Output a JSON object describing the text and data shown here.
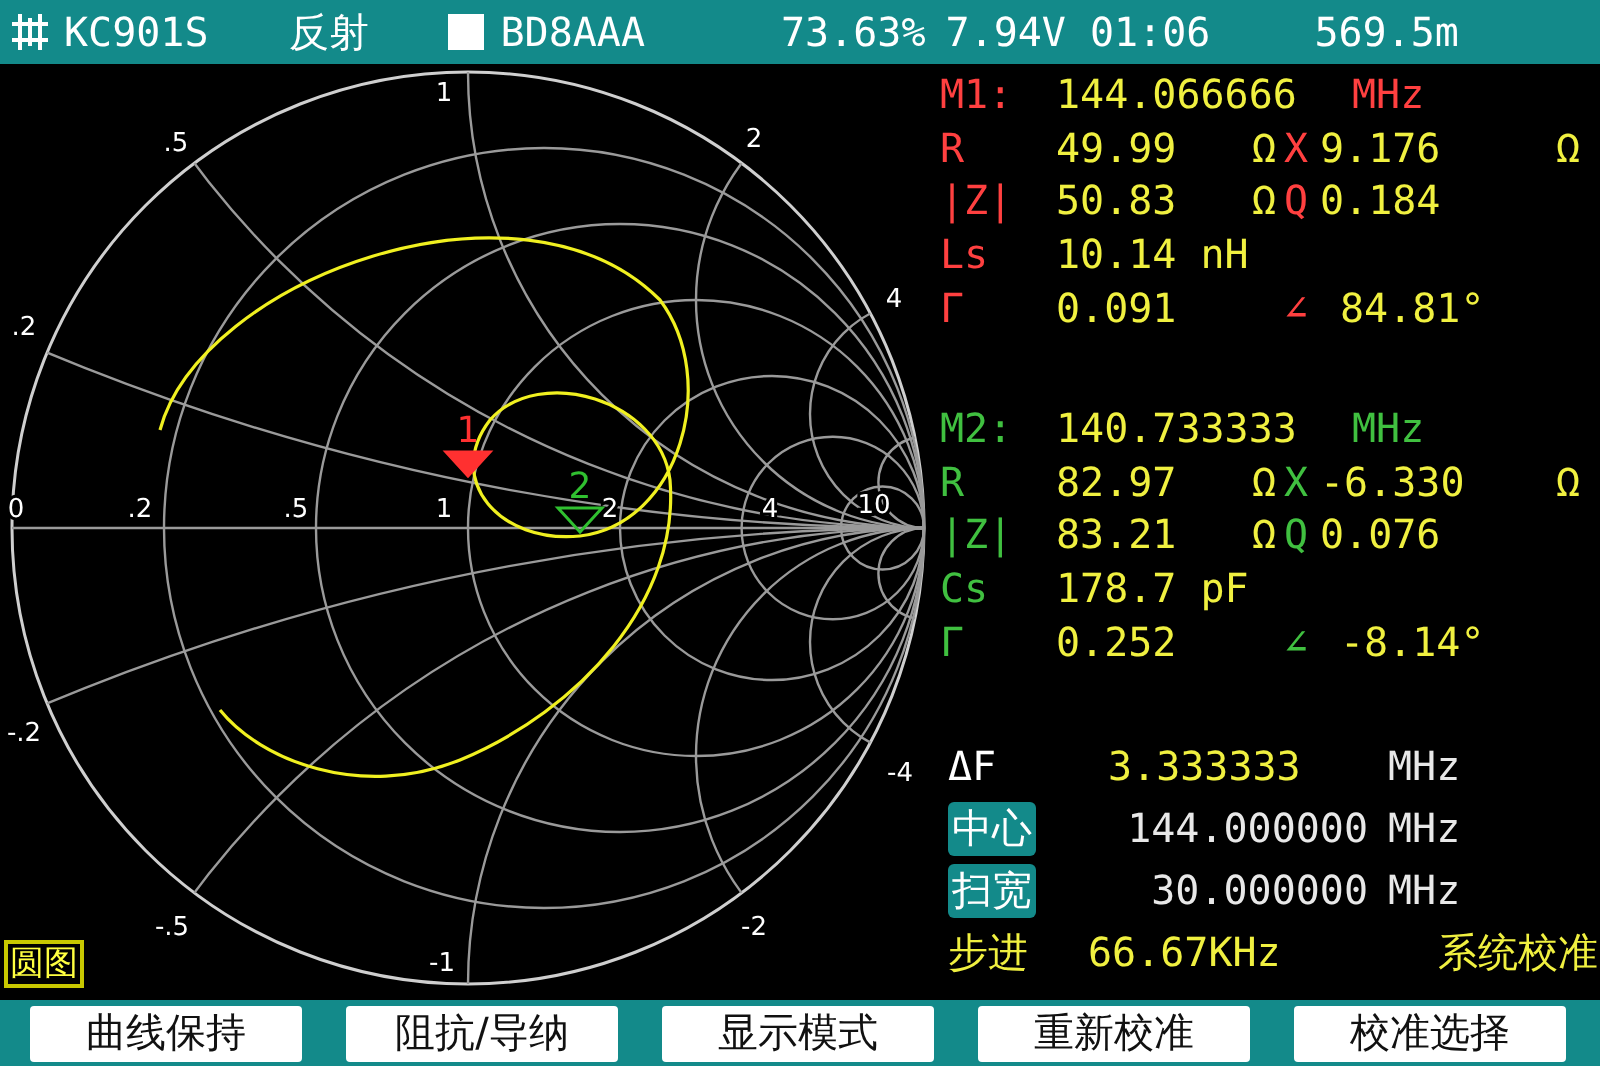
{
  "status_bar": {
    "model": "KC901S",
    "mode": "反射",
    "callsign": "BD8AAA",
    "battery": "73.63%",
    "voltage": "7.94V",
    "time": "01:06",
    "readout": "569.5m"
  },
  "smith_chart": {
    "labels": [
      ".5",
      "1",
      "2",
      ".2",
      "4",
      "0",
      ".2",
      ".5",
      "1",
      "2",
      "4",
      "10",
      "-.2",
      "-4",
      "-.5",
      "-2",
      "-1"
    ],
    "markers": [
      {
        "label": "1",
        "color": "#ff3030",
        "filled": true
      },
      {
        "label": "2",
        "color": "#30c030",
        "filled": false
      }
    ],
    "view_label": "圆图"
  },
  "markers": [
    {
      "title": "M1:",
      "freq": "144.066666",
      "unit": "MHz",
      "color": "#ff4040",
      "lines": [
        {
          "label": "R",
          "value": "49.99",
          "unit": "Ω",
          "label2": "X",
          "value2": "9.176",
          "unit2": "Ω"
        },
        {
          "label": "|Z|",
          "value": "50.83",
          "unit": "Ω",
          "label2": "Q",
          "value2": "0.184"
        },
        {
          "label": "Ls",
          "value": "10.14 nH"
        },
        {
          "label": "Γ",
          "value": "0.091",
          "label2": "∠",
          "value2": "84.81°"
        }
      ]
    },
    {
      "title": "M2:",
      "freq": "140.733333",
      "unit": "MHz",
      "color": "#40c040",
      "lines": [
        {
          "label": "R",
          "value": "82.97",
          "unit": "Ω",
          "label2": "X",
          "value2": "-6.330",
          "unit2": "Ω"
        },
        {
          "label": "|Z|",
          "value": "83.21",
          "unit": "Ω",
          "label2": "Q",
          "value2": "0.076"
        },
        {
          "label": "Cs",
          "value": "178.7 pF"
        },
        {
          "label": "Γ",
          "value": "0.252",
          "label2": "∠",
          "value2": "-8.14°"
        }
      ]
    }
  ],
  "sweep": [
    {
      "kind": "delta",
      "label": "ΔF",
      "value": "3.333333",
      "unit": "MHz"
    },
    {
      "kind": "boxed",
      "label": "中心",
      "value": "144.000000",
      "unit": "MHz"
    },
    {
      "kind": "boxed",
      "label": "扫宽",
      "value": "30.000000",
      "unit": "MHz"
    },
    {
      "kind": "step",
      "label": "步进",
      "value": "66.67KHz",
      "unit": "系统校准"
    }
  ],
  "buttons": [
    "曲线保持",
    "阻抗/导纳",
    "显示模式",
    "重新校准",
    "校准选择"
  ]
}
